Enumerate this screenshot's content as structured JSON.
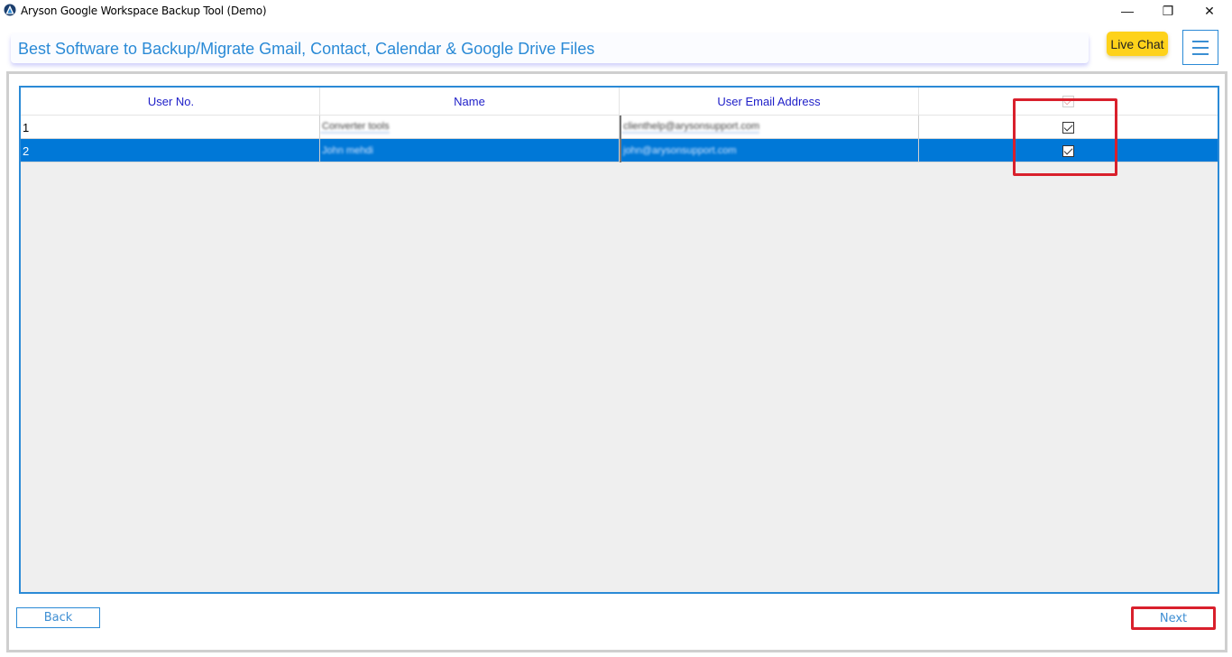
{
  "window": {
    "title": "Aryson Google Workspace Backup Tool (Demo)",
    "controls": {
      "minimize": "—",
      "maximize": "❐",
      "close": "✕"
    }
  },
  "header": {
    "banner_text": "Best Software to Backup/Migrate Gmail, Contact, Calendar & Google Drive Files",
    "live_chat_label": "Live Chat",
    "menu_icon": "hamburger-menu-icon"
  },
  "table": {
    "columns": [
      "User No.",
      "Name",
      "User Email Address",
      ""
    ],
    "header_checkbox_checked": true,
    "rows": [
      {
        "user_no": "1",
        "name": "Converter tools",
        "email": "clienthelp@arysonsupport.com",
        "checked": true,
        "selected": false
      },
      {
        "user_no": "2",
        "name": "John mehdi",
        "email": "john@arysonsupport.com",
        "checked": true,
        "selected": true
      }
    ]
  },
  "footer": {
    "back_label": "Back",
    "next_label": "Next"
  },
  "colors": {
    "accent_blue": "#2b8ad6",
    "selection_blue": "#0078d7",
    "live_chat_yellow": "#fed21a",
    "highlight_red": "#d9202c",
    "header_text": "#1e1ec8"
  }
}
